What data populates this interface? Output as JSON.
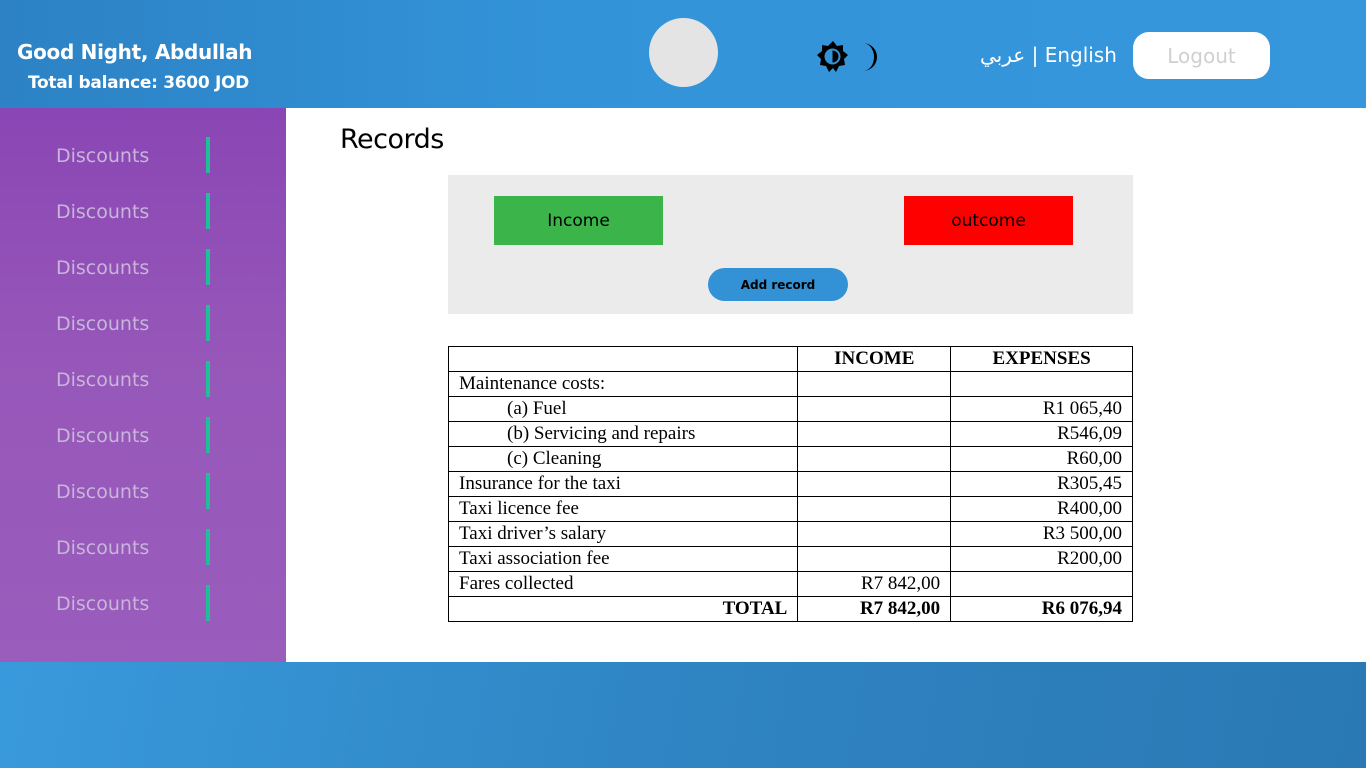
{
  "header": {
    "greeting": "Good Night, Abdullah",
    "balance": "Total balance: 3600 JOD",
    "theme_icons": [
      "sun-icon",
      "moon-icon"
    ],
    "lang_arabic": "عربي",
    "lang_separator": "|",
    "lang_english": "English",
    "logout_label": "Logout"
  },
  "sidebar": {
    "items": [
      {
        "label": "Discounts"
      },
      {
        "label": "Discounts"
      },
      {
        "label": "Discounts"
      },
      {
        "label": "Discounts"
      },
      {
        "label": "Discounts"
      },
      {
        "label": "Discounts"
      },
      {
        "label": "Discounts"
      },
      {
        "label": "Discounts"
      },
      {
        "label": "Discounts"
      }
    ]
  },
  "main": {
    "title": "Records",
    "income_label": "Income",
    "outcome_label": "outcome",
    "add_record_label": "Add record",
    "table": {
      "headers": [
        "",
        "INCOME",
        "EXPENSES"
      ],
      "rows": [
        {
          "label": "Maintenance costs:",
          "income": "",
          "expenses": ""
        },
        {
          "label": "(a)  Fuel",
          "income": "",
          "expenses": "R1 065,40"
        },
        {
          "label": "(b)  Servicing and repairs",
          "income": "",
          "expenses": "R546,09"
        },
        {
          "label": "(c)  Cleaning",
          "income": "",
          "expenses": "R60,00"
        },
        {
          "label": "Insurance for the taxi",
          "income": "",
          "expenses": "R305,45"
        },
        {
          "label": "Taxi licence fee",
          "income": "",
          "expenses": "R400,00"
        },
        {
          "label": "Taxi driver’s salary",
          "income": "",
          "expenses": "R3 500,00"
        },
        {
          "label": "Taxi association fee",
          "income": "",
          "expenses": "R200,00"
        },
        {
          "label": "Fares collected",
          "income": "R7 842,00",
          "expenses": ""
        }
      ],
      "total": {
        "label": "TOTAL",
        "income": "R7 842,00",
        "expenses": "R6 076,94"
      }
    }
  },
  "colors": {
    "header": "#3393d8",
    "sidebar": "#9055b8",
    "sidebar_accent": "#1fbf9a",
    "income_button": "#3bb54a",
    "outcome_button": "#ff0000",
    "add_button": "#3391d6"
  }
}
